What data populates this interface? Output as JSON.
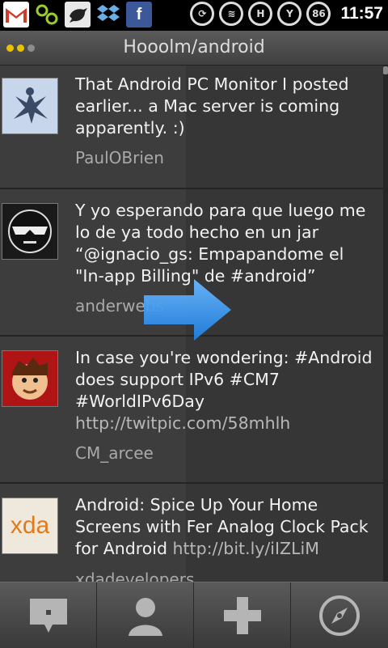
{
  "status_bar": {
    "time": "11:57",
    "battery": "86",
    "notification_icons": [
      "gmail-icon",
      "contacts-sync-icon",
      "tweet-bird-icon",
      "dropbox-icon",
      "facebook-icon"
    ],
    "status_icons": [
      "sync-icon",
      "wifi-icon",
      "network-h-icon",
      "signal-icon",
      "battery-icon"
    ]
  },
  "title_bar": {
    "title": "Hooolm/android",
    "dot_colors": [
      "#e8c200",
      "#e8c200",
      "#8c8c8c"
    ]
  },
  "feed": [
    {
      "text": "That Android PC Monitor I posted earlier... a Mac server is coming apparently. :)",
      "link": "",
      "author": "PaulOBrien",
      "avatar": "snow-angel-photo"
    },
    {
      "text": "Y yo esperando para que luego me lo de ya todo hecho en un jar “@ignacio_gs: Empapandome el \"In-app Billing\" de #android”",
      "link": "",
      "author": "anderwebs",
      "avatar": "masked-face-avatar"
    },
    {
      "text": "In case you're wondering: #Android does support IPv6 #CM7 #WorldIPv6Day",
      "link": "http://twitpic.com/58mhlh",
      "author": "CM_arcee",
      "avatar": "cartoon-man-avatar"
    },
    {
      "text": "Android:  Spice Up Your Home Screens with Fer Analog Clock Pack for Android",
      "link": "http://bit.ly/iIZLiM",
      "author": "xdadevelopers",
      "avatar": "xda",
      "avatar_color": "#e07a1a"
    }
  ],
  "swipe_arrow_color": "#3399ee",
  "bottom_bar": {
    "tabs": [
      "compose-icon",
      "profile-icon",
      "add-icon",
      "explore-compass-icon"
    ]
  }
}
